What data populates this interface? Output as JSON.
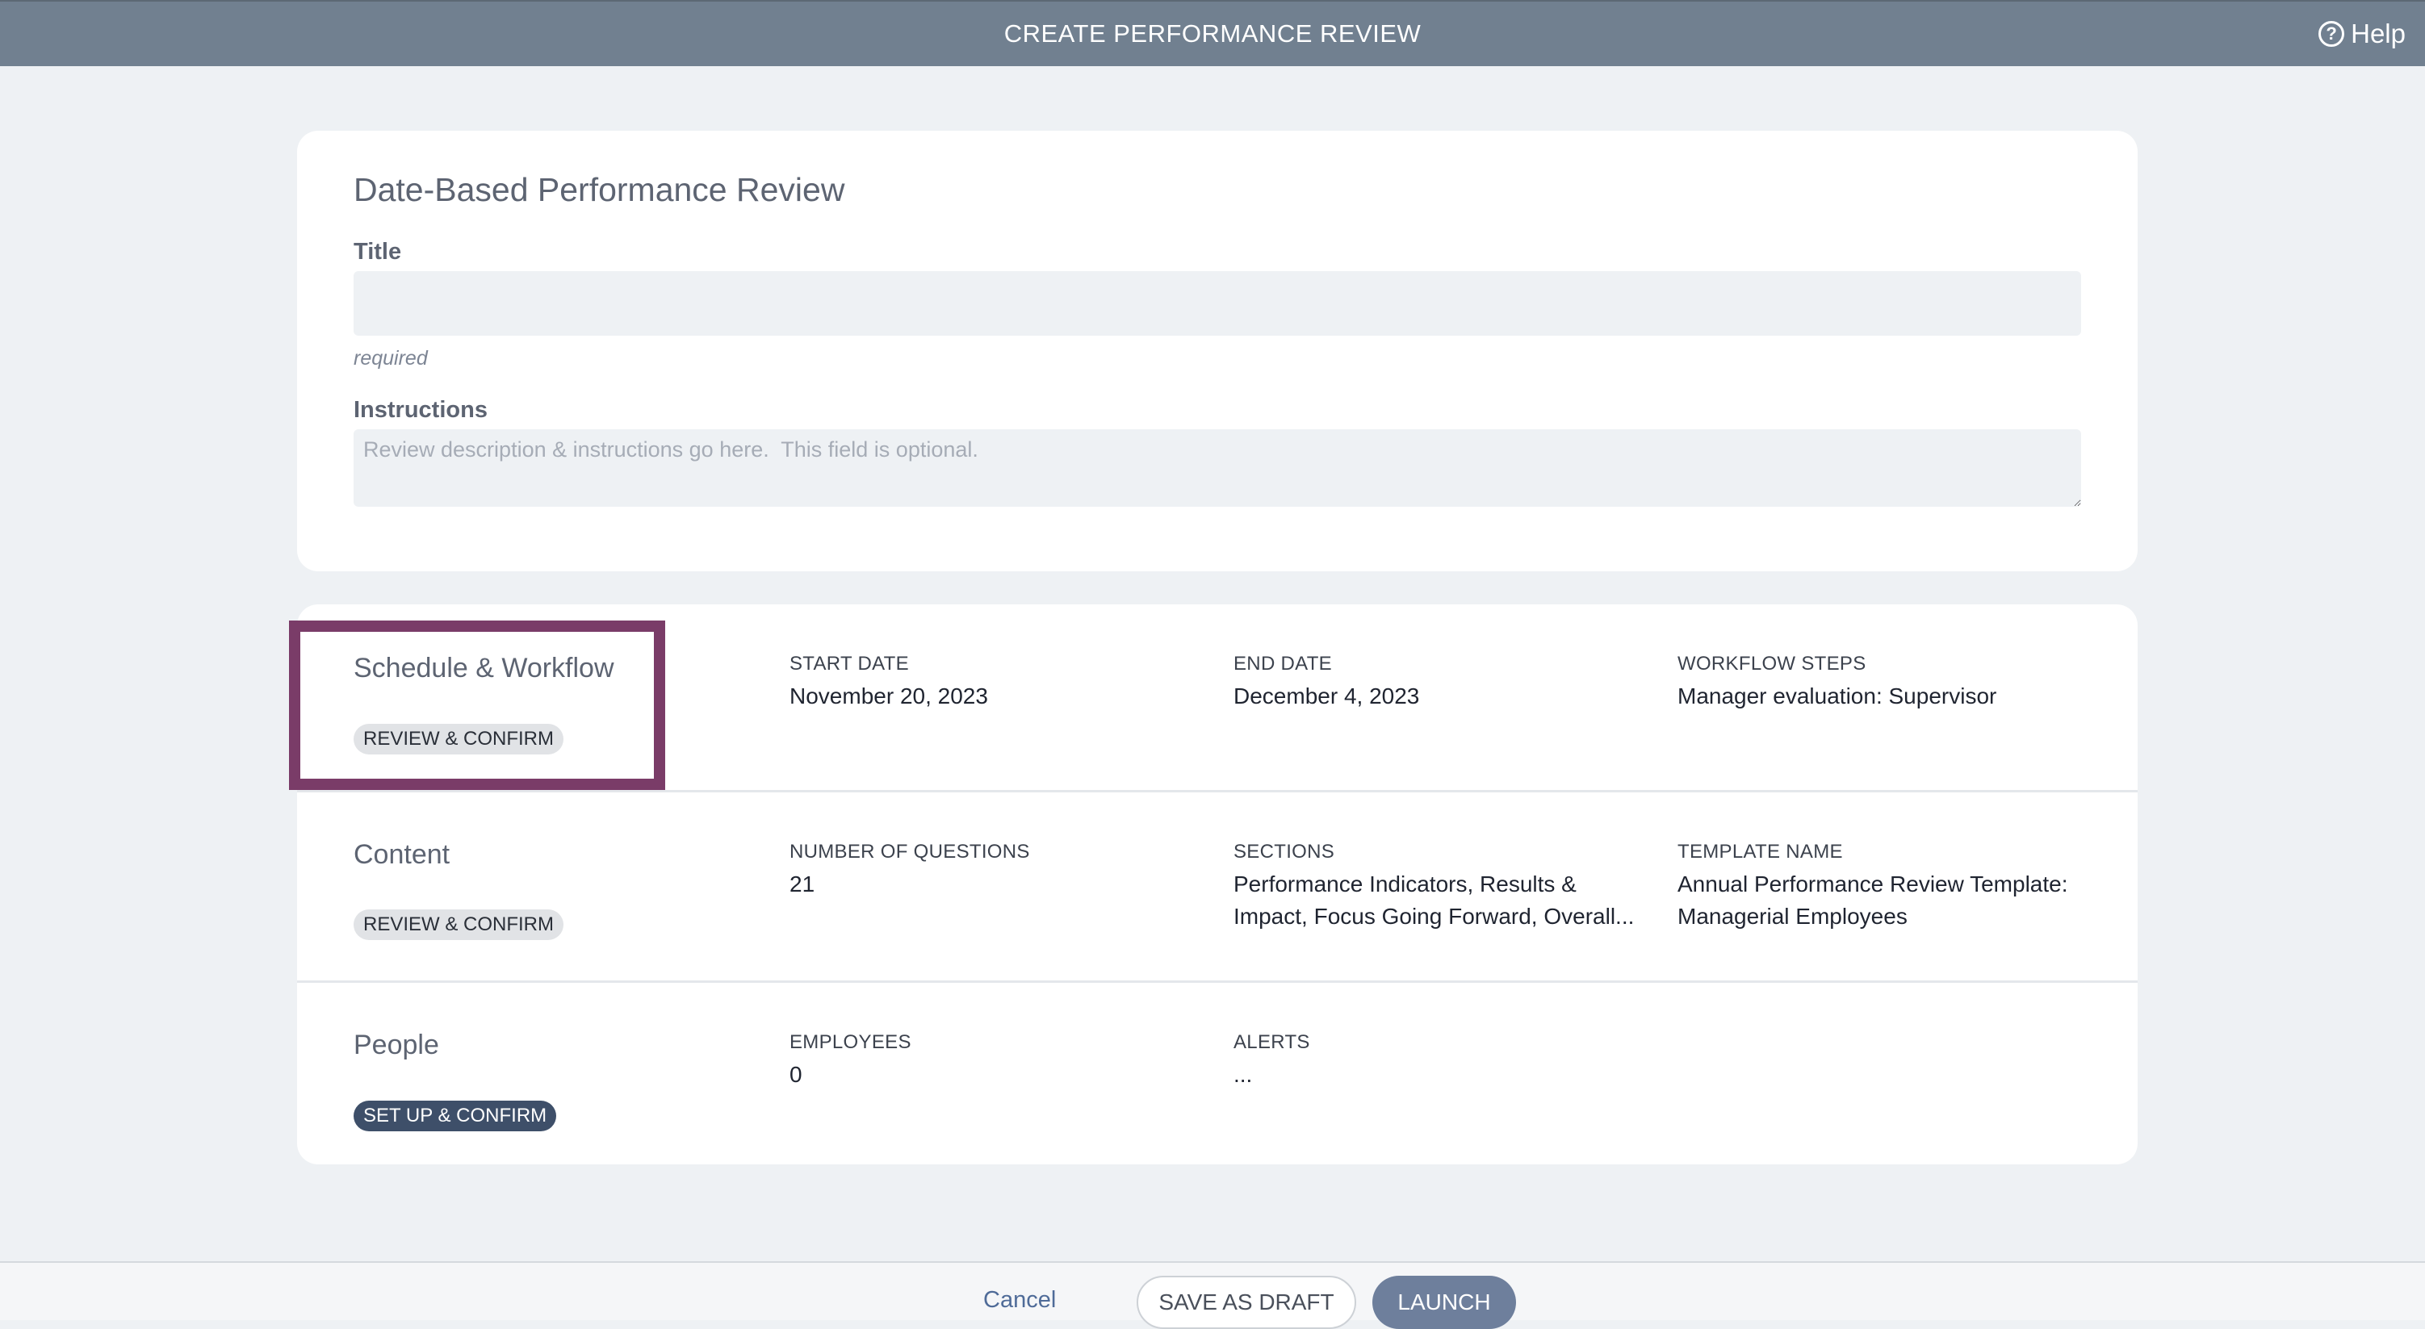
{
  "header": {
    "title": "CREATE PERFORMANCE REVIEW",
    "help_label": "Help",
    "help_icon": "question-circle-icon"
  },
  "review_form": {
    "heading": "Date-Based Performance Review",
    "title_label": "Title",
    "title_value": "",
    "title_hint": "required",
    "instructions_label": "Instructions",
    "instructions_placeholder": "Review description & instructions go here.  This field is optional."
  },
  "sections": {
    "schedule": {
      "title": "Schedule & Workflow",
      "action": "REVIEW & CONFIRM",
      "start_label": "START DATE",
      "start_value": "November 20, 2023",
      "end_label": "END DATE",
      "end_value": "December 4, 2023",
      "workflow_label": "WORKFLOW STEPS",
      "workflow_value": "Manager evaluation: Supervisor"
    },
    "content": {
      "title": "Content",
      "action": "REVIEW & CONFIRM",
      "questions_label": "NUMBER OF QUESTIONS",
      "questions_value": "21",
      "sections_label": "SECTIONS",
      "sections_value": "Performance Indicators, Results & Impact, Focus Going Forward, Overall...",
      "template_label": "TEMPLATE NAME",
      "template_value": "Annual Performance Review Template: Managerial Employees"
    },
    "people": {
      "title": "People",
      "action": "SET UP & CONFIRM",
      "employees_label": "EMPLOYEES",
      "employees_value": "0",
      "alerts_label": "ALERTS",
      "alerts_value": "..."
    }
  },
  "footer": {
    "cancel_label": "Cancel",
    "draft_label": "SAVE AS DRAFT",
    "launch_label": "LAUNCH"
  },
  "colors": {
    "header_bg": "#718090",
    "highlight": "#7a3c68",
    "primary_pill": "#3e4f69",
    "launch": "#6e7f9c"
  }
}
